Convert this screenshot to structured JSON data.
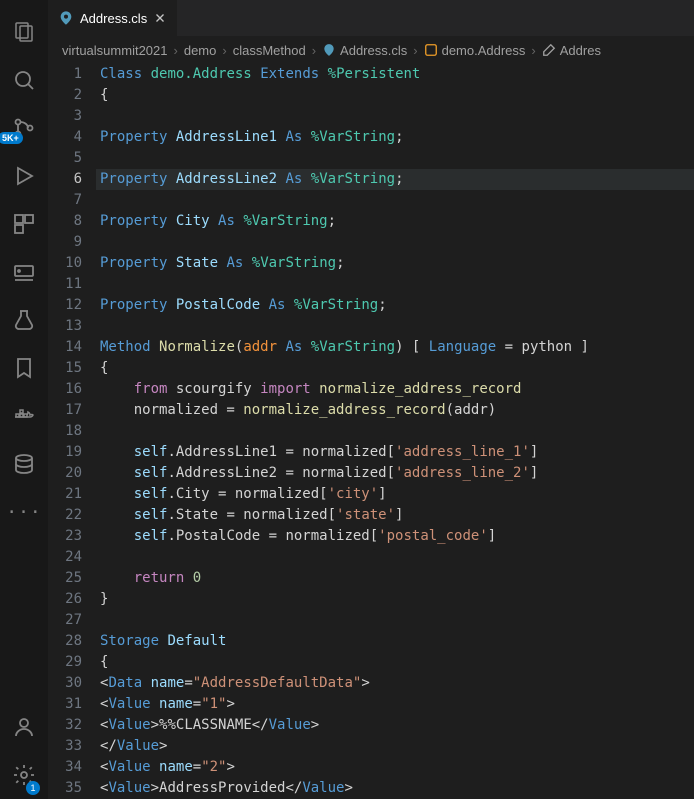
{
  "activity": {
    "badge_5k": "5K+",
    "badge_settings": "1"
  },
  "tab": {
    "title": "Address.cls"
  },
  "breadcrumb": {
    "seg1": "virtualsummit2021",
    "seg2": "demo",
    "seg3": "classMethod",
    "seg4": "Address.cls",
    "seg5": "demo.Address",
    "seg6": "Addres"
  },
  "code": {
    "active_line": 6,
    "lines": [
      {
        "n": 1,
        "tokens": [
          {
            "c": "kw",
            "t": "Class"
          },
          {
            "c": "id",
            "t": " "
          },
          {
            "c": "cls",
            "t": "demo.Address"
          },
          {
            "c": "id",
            "t": " "
          },
          {
            "c": "kw",
            "t": "Extends"
          },
          {
            "c": "id",
            "t": " "
          },
          {
            "c": "cls",
            "t": "%Persistent"
          }
        ]
      },
      {
        "n": 2,
        "tokens": [
          {
            "c": "punc",
            "t": "{"
          }
        ]
      },
      {
        "n": 3,
        "tokens": []
      },
      {
        "n": 4,
        "tokens": [
          {
            "c": "kw",
            "t": "Property"
          },
          {
            "c": "id",
            "t": " "
          },
          {
            "c": "prop",
            "t": "AddressLine1"
          },
          {
            "c": "id",
            "t": " "
          },
          {
            "c": "kw",
            "t": "As"
          },
          {
            "c": "id",
            "t": " "
          },
          {
            "c": "cls",
            "t": "%VarString"
          },
          {
            "c": "punc",
            "t": ";"
          }
        ]
      },
      {
        "n": 5,
        "tokens": []
      },
      {
        "n": 6,
        "tokens": [
          {
            "c": "kw",
            "t": "Property"
          },
          {
            "c": "id",
            "t": " "
          },
          {
            "c": "prop",
            "t": "AddressLine2"
          },
          {
            "c": "id",
            "t": " "
          },
          {
            "c": "kw",
            "t": "As"
          },
          {
            "c": "id",
            "t": " "
          },
          {
            "c": "cls",
            "t": "%VarString"
          },
          {
            "c": "punc",
            "t": ";"
          }
        ]
      },
      {
        "n": 7,
        "tokens": []
      },
      {
        "n": 8,
        "tokens": [
          {
            "c": "kw",
            "t": "Property"
          },
          {
            "c": "id",
            "t": " "
          },
          {
            "c": "prop",
            "t": "City"
          },
          {
            "c": "id",
            "t": " "
          },
          {
            "c": "kw",
            "t": "As"
          },
          {
            "c": "id",
            "t": " "
          },
          {
            "c": "cls",
            "t": "%VarString"
          },
          {
            "c": "punc",
            "t": ";"
          }
        ]
      },
      {
        "n": 9,
        "tokens": []
      },
      {
        "n": 10,
        "tokens": [
          {
            "c": "kw",
            "t": "Property"
          },
          {
            "c": "id",
            "t": " "
          },
          {
            "c": "prop",
            "t": "State"
          },
          {
            "c": "id",
            "t": " "
          },
          {
            "c": "kw",
            "t": "As"
          },
          {
            "c": "id",
            "t": " "
          },
          {
            "c": "cls",
            "t": "%VarString"
          },
          {
            "c": "punc",
            "t": ";"
          }
        ]
      },
      {
        "n": 11,
        "tokens": []
      },
      {
        "n": 12,
        "tokens": [
          {
            "c": "kw",
            "t": "Property"
          },
          {
            "c": "id",
            "t": " "
          },
          {
            "c": "prop",
            "t": "PostalCode"
          },
          {
            "c": "id",
            "t": " "
          },
          {
            "c": "kw",
            "t": "As"
          },
          {
            "c": "id",
            "t": " "
          },
          {
            "c": "cls",
            "t": "%VarString"
          },
          {
            "c": "punc",
            "t": ";"
          }
        ]
      },
      {
        "n": 13,
        "tokens": []
      },
      {
        "n": 14,
        "tokens": [
          {
            "c": "kw",
            "t": "Method"
          },
          {
            "c": "id",
            "t": " "
          },
          {
            "c": "fn",
            "t": "Normalize"
          },
          {
            "c": "punc",
            "t": "("
          },
          {
            "c": "param",
            "t": "addr"
          },
          {
            "c": "id",
            "t": " "
          },
          {
            "c": "kw",
            "t": "As"
          },
          {
            "c": "id",
            "t": " "
          },
          {
            "c": "cls",
            "t": "%VarString"
          },
          {
            "c": "punc",
            "t": ") [ "
          },
          {
            "c": "kw",
            "t": "Language"
          },
          {
            "c": "punc",
            "t": " = "
          },
          {
            "c": "id",
            "t": "python"
          },
          {
            "c": "punc",
            "t": " ]"
          }
        ]
      },
      {
        "n": 15,
        "tokens": [
          {
            "c": "punc",
            "t": "{"
          }
        ]
      },
      {
        "n": 16,
        "tokens": [
          {
            "c": "id",
            "t": "    "
          },
          {
            "c": "kw2",
            "t": "from"
          },
          {
            "c": "id",
            "t": " scourgify "
          },
          {
            "c": "kw2",
            "t": "import"
          },
          {
            "c": "id",
            "t": " "
          },
          {
            "c": "fn",
            "t": "normalize_address_record"
          }
        ]
      },
      {
        "n": 17,
        "tokens": [
          {
            "c": "id",
            "t": "    normalized = "
          },
          {
            "c": "fn",
            "t": "normalize_address_record"
          },
          {
            "c": "punc",
            "t": "("
          },
          {
            "c": "id",
            "t": "addr"
          },
          {
            "c": "punc",
            "t": ")"
          }
        ]
      },
      {
        "n": 18,
        "tokens": []
      },
      {
        "n": 19,
        "tokens": [
          {
            "c": "id",
            "t": "    "
          },
          {
            "c": "self",
            "t": "self"
          },
          {
            "c": "punc",
            "t": "."
          },
          {
            "c": "id",
            "t": "AddressLine1 = normalized["
          },
          {
            "c": "str",
            "t": "'address_line_1'"
          },
          {
            "c": "punc",
            "t": "]"
          }
        ]
      },
      {
        "n": 20,
        "tokens": [
          {
            "c": "id",
            "t": "    "
          },
          {
            "c": "self",
            "t": "self"
          },
          {
            "c": "punc",
            "t": "."
          },
          {
            "c": "id",
            "t": "AddressLine2 = normalized["
          },
          {
            "c": "str",
            "t": "'address_line_2'"
          },
          {
            "c": "punc",
            "t": "]"
          }
        ]
      },
      {
        "n": 21,
        "tokens": [
          {
            "c": "id",
            "t": "    "
          },
          {
            "c": "self",
            "t": "self"
          },
          {
            "c": "punc",
            "t": "."
          },
          {
            "c": "id",
            "t": "City = normalized["
          },
          {
            "c": "str",
            "t": "'city'"
          },
          {
            "c": "punc",
            "t": "]"
          }
        ]
      },
      {
        "n": 22,
        "tokens": [
          {
            "c": "id",
            "t": "    "
          },
          {
            "c": "self",
            "t": "self"
          },
          {
            "c": "punc",
            "t": "."
          },
          {
            "c": "id",
            "t": "State = normalized["
          },
          {
            "c": "str",
            "t": "'state'"
          },
          {
            "c": "punc",
            "t": "]"
          }
        ]
      },
      {
        "n": 23,
        "tokens": [
          {
            "c": "id",
            "t": "    "
          },
          {
            "c": "self",
            "t": "self"
          },
          {
            "c": "punc",
            "t": "."
          },
          {
            "c": "id",
            "t": "PostalCode = normalized["
          },
          {
            "c": "str",
            "t": "'postal_code'"
          },
          {
            "c": "punc",
            "t": "]"
          }
        ]
      },
      {
        "n": 24,
        "tokens": []
      },
      {
        "n": 25,
        "tokens": [
          {
            "c": "id",
            "t": "    "
          },
          {
            "c": "kw2",
            "t": "return"
          },
          {
            "c": "id",
            "t": " "
          },
          {
            "c": "num",
            "t": "0"
          }
        ]
      },
      {
        "n": 26,
        "tokens": [
          {
            "c": "punc",
            "t": "}"
          }
        ]
      },
      {
        "n": 27,
        "tokens": []
      },
      {
        "n": 28,
        "tokens": [
          {
            "c": "kw",
            "t": "Storage"
          },
          {
            "c": "id",
            "t": " "
          },
          {
            "c": "prop",
            "t": "Default"
          }
        ]
      },
      {
        "n": 29,
        "tokens": [
          {
            "c": "punc",
            "t": "{"
          }
        ]
      },
      {
        "n": 30,
        "tokens": [
          {
            "c": "punc",
            "t": "<"
          },
          {
            "c": "tag",
            "t": "Data"
          },
          {
            "c": "id",
            "t": " "
          },
          {
            "c": "attr",
            "t": "name"
          },
          {
            "c": "punc",
            "t": "="
          },
          {
            "c": "str",
            "t": "\"AddressDefaultData\""
          },
          {
            "c": "punc",
            "t": ">"
          }
        ]
      },
      {
        "n": 31,
        "tokens": [
          {
            "c": "punc",
            "t": "<"
          },
          {
            "c": "tag",
            "t": "Value"
          },
          {
            "c": "id",
            "t": " "
          },
          {
            "c": "attr",
            "t": "name"
          },
          {
            "c": "punc",
            "t": "="
          },
          {
            "c": "str",
            "t": "\"1\""
          },
          {
            "c": "punc",
            "t": ">"
          }
        ]
      },
      {
        "n": 32,
        "tokens": [
          {
            "c": "punc",
            "t": "<"
          },
          {
            "c": "tag",
            "t": "Value"
          },
          {
            "c": "punc",
            "t": ">"
          },
          {
            "c": "txt",
            "t": "%%CLASSNAME"
          },
          {
            "c": "punc",
            "t": "</"
          },
          {
            "c": "tag",
            "t": "Value"
          },
          {
            "c": "punc",
            "t": ">"
          }
        ]
      },
      {
        "n": 33,
        "tokens": [
          {
            "c": "punc",
            "t": "</"
          },
          {
            "c": "tag",
            "t": "Value"
          },
          {
            "c": "punc",
            "t": ">"
          }
        ]
      },
      {
        "n": 34,
        "tokens": [
          {
            "c": "punc",
            "t": "<"
          },
          {
            "c": "tag",
            "t": "Value"
          },
          {
            "c": "id",
            "t": " "
          },
          {
            "c": "attr",
            "t": "name"
          },
          {
            "c": "punc",
            "t": "="
          },
          {
            "c": "str",
            "t": "\"2\""
          },
          {
            "c": "punc",
            "t": ">"
          }
        ]
      },
      {
        "n": 35,
        "tokens": [
          {
            "c": "punc",
            "t": "<"
          },
          {
            "c": "tag",
            "t": "Value"
          },
          {
            "c": "punc",
            "t": ">"
          },
          {
            "c": "txt",
            "t": "AddressProvided"
          },
          {
            "c": "punc",
            "t": "</"
          },
          {
            "c": "tag",
            "t": "Value"
          },
          {
            "c": "punc",
            "t": ">"
          }
        ]
      }
    ]
  }
}
